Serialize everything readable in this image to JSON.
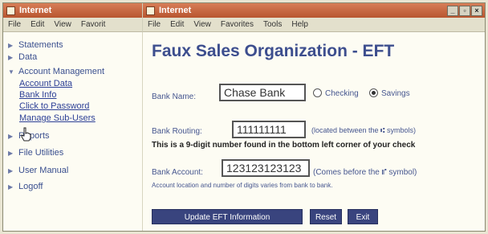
{
  "left_window": {
    "title": "Internet",
    "menu": [
      "File",
      "Edit",
      "View",
      "Favorit"
    ]
  },
  "right_window": {
    "title": "Internet",
    "menu": [
      "File",
      "Edit",
      "View",
      "Favorites",
      "Tools",
      "Help"
    ],
    "controls": [
      "_",
      "▫",
      "×"
    ]
  },
  "sidebar": {
    "items": [
      {
        "label": "Statements"
      },
      {
        "label": "Data"
      },
      {
        "label": "Account Management"
      },
      {
        "label": "Reports"
      },
      {
        "label": "File Utilities"
      },
      {
        "label": "User Manual"
      },
      {
        "label": "Logoff"
      }
    ],
    "sub_items": [
      {
        "label": "Account Data"
      },
      {
        "label": "Bank Info"
      },
      {
        "label": "Click to Password"
      },
      {
        "label": "Manage Sub-Users"
      }
    ]
  },
  "form": {
    "page_title": "Faux Sales Organization  -  EFT",
    "bank_name_label": "Bank Name:",
    "bank_name_value": "Chase Bank",
    "checking_label": "Checking",
    "savings_label": "Savings",
    "selected_account_type": "Savings",
    "bank_routing_label": "Bank Routing:",
    "bank_routing_value": "111111111",
    "routing_hint": "(located between the ⑆ symbols)",
    "routing_note": "This is a 9-digit number found in the bottom left corner of your check",
    "bank_account_label": "Bank Account:",
    "bank_account_value": "123123123123",
    "account_hint": "(Comes before the ⑈ symbol)",
    "account_note": "Account location and number of digits varies from bank to bank.",
    "update_button": "Update EFT Information",
    "reset_button": "Reset",
    "exit_button": "Exit"
  },
  "colors": {
    "title_bar": "#b8552f",
    "heading": "#3d4e8e",
    "button": "#39447e"
  }
}
